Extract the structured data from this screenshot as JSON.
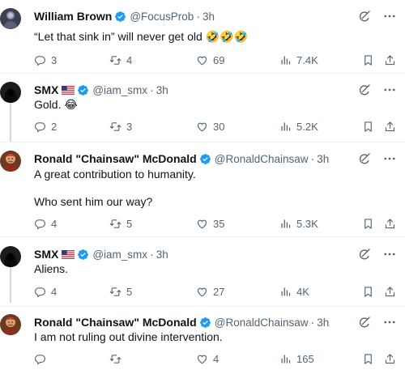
{
  "tweets": [
    {
      "name": "William Brown",
      "flag": false,
      "handle": "@FocusProb",
      "time": "3h",
      "text": "“Let that sink in” will never get old 🤣🤣🤣",
      "replies": "3",
      "retweets": "4",
      "likes": "69",
      "views": "7.4K",
      "avatar": "dark-figure-avatar"
    },
    {
      "name": "SMX",
      "flag": true,
      "handle": "@iam_smx",
      "time": "3h",
      "text": "Gold. 😂",
      "replies": "2",
      "retweets": "3",
      "likes": "30",
      "views": "5.2K",
      "avatar": "hooded-avatar"
    },
    {
      "name": "Ronald \"Chainsaw\" McDonald",
      "flag": false,
      "handle": "@RonaldChainsaw",
      "time": "3h",
      "text": "A great contribution to humanity.\n\nWho sent him our way?",
      "replies": "4",
      "retweets": "5",
      "likes": "35",
      "views": "5.3K",
      "avatar": "portrait-avatar"
    },
    {
      "name": "SMX",
      "flag": true,
      "handle": "@iam_smx",
      "time": "3h",
      "text": "Aliens.",
      "replies": "4",
      "retweets": "5",
      "likes": "27",
      "views": "4K",
      "avatar": "hooded-avatar"
    },
    {
      "name": "Ronald \"Chainsaw\" McDonald",
      "flag": false,
      "handle": "@RonaldChainsaw",
      "time": "3h",
      "text": "I am not ruling out divine intervention.",
      "replies": "",
      "retweets": "",
      "likes": "4",
      "views": "165",
      "avatar": "portrait-avatar"
    }
  ],
  "colors": {
    "verified": "#1d9bf0",
    "secondary_text": "#536471",
    "primary_text": "#0f1419",
    "divider": "#eff3f4"
  },
  "icons": [
    "reply-icon",
    "retweet-icon",
    "like-icon",
    "views-icon",
    "bookmark-icon",
    "share-icon",
    "grok-icon",
    "more-icon",
    "verified-badge-icon",
    "us-flag-icon"
  ]
}
